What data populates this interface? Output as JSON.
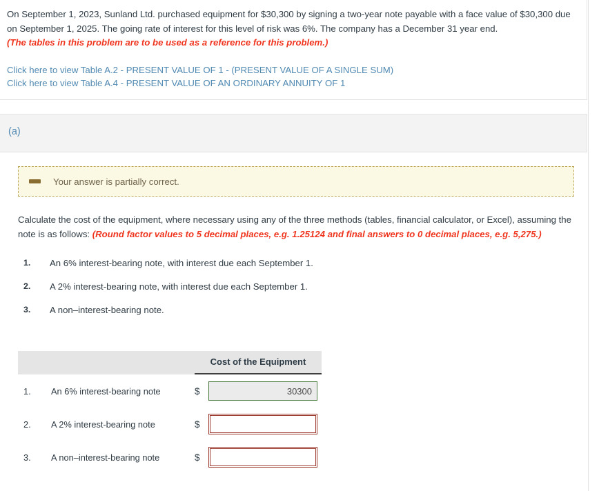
{
  "problem": {
    "statement": "On September 1, 2023, Sunland Ltd. purchased equipment for $30,300 by signing a two-year note payable with a face value of $30,300 due on September 1, 2025. The going rate of interest for this level of risk was 6%. The company has a December 31 year end.",
    "note": "(The tables in this problem are to be used as a reference for this problem.)",
    "links": [
      "Click here to view Table A.2 - PRESENT VALUE OF 1 - (PRESENT VALUE OF A SINGLE SUM)",
      "Click here to view Table A.4 - PRESENT VALUE OF AN ORDINARY ANNUITY OF 1"
    ]
  },
  "part": {
    "label": "(a)"
  },
  "alert": {
    "icon": "minus-icon",
    "message": "Your answer is partially correct.",
    "background": "#fbf8e3",
    "border_color": "#bba452",
    "icon_color": "#8a6d30"
  },
  "instruction": {
    "text": "Calculate the cost of the equipment, where necessary using any of the three methods (tables, financial calculator, or Excel), assuming the note is as follows:",
    "note": "(Round factor values to 5 decimal places, e.g. 1.25124 and final answers to 0 decimal places, e.g. 5,275.)"
  },
  "note_list": [
    {
      "number": "1.",
      "text": "An 6% interest-bearing note, with interest due each September 1."
    },
    {
      "number": "2.",
      "text": "A 2% interest-bearing note, with interest due each September 1."
    },
    {
      "number": "3.",
      "text": "A non–interest-bearing note."
    }
  ],
  "answer_table": {
    "header": {
      "blank": "",
      "cost_column": "Cost of the Equipment"
    },
    "currency_symbol": "$",
    "rows": [
      {
        "number": "1.",
        "label": "An 6% interest-bearing note",
        "value": "30300",
        "status": "correct",
        "border_color": "#4a7c3f",
        "fill_color": "#ebebeb"
      },
      {
        "number": "2.",
        "label": "A 2% interest-bearing note",
        "value": "",
        "status": "incorrect",
        "border_color": "#9e3b30",
        "fill_color": "#ffffff"
      },
      {
        "number": "3.",
        "label": "A non–interest-bearing note",
        "value": "",
        "status": "incorrect",
        "border_color": "#9e3b30",
        "fill_color": "#ffffff"
      }
    ]
  },
  "colors": {
    "link": "#5089b2",
    "warning_text": "#f0351f",
    "body_text": "#2f3b44",
    "band_background": "#f3f3f3",
    "table_header_background": "#e5e5e5"
  }
}
